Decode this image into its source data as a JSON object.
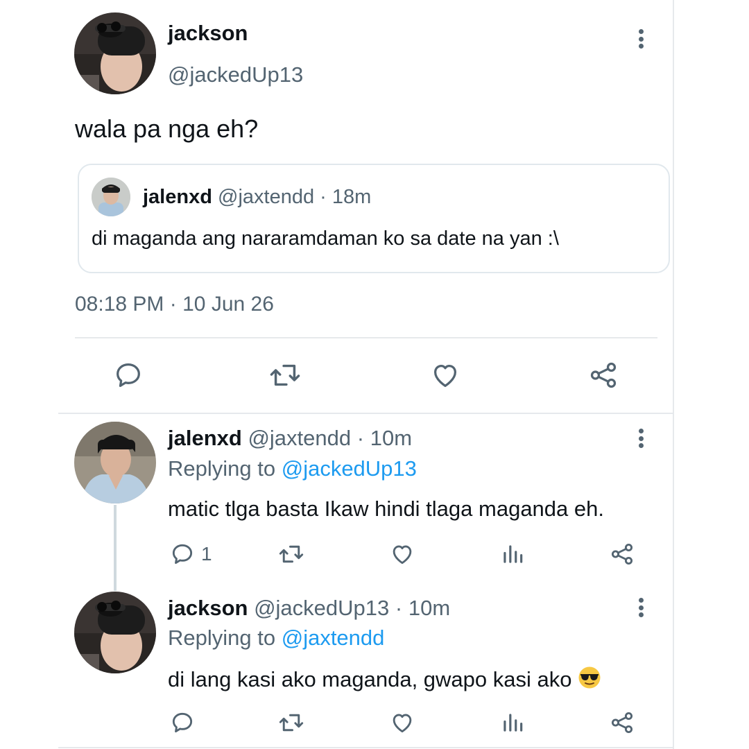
{
  "main_tweet": {
    "author_name": "jackson",
    "author_handle": "@jackedUp13",
    "text": "wala pa nga eh?",
    "quoted": {
      "author_name": "jalenxd",
      "author_handle": "@jaxtendd",
      "separator": "·",
      "time": "18m",
      "text": "di maganda ang nararamdaman ko sa date na yan :\\"
    },
    "time": "08:18 PM",
    "separator": "·",
    "date": "10 Jun 26",
    "actions": [
      "reply-icon",
      "retweet-icon",
      "like-icon",
      "share-icon"
    ]
  },
  "replies": [
    {
      "author_name": "jalenxd",
      "author_handle": "@jaxtendd",
      "separator": "·",
      "time": "10m",
      "replying_prefix": "Replying to",
      "replying_to": "@jackedUp13",
      "text": "matic tlga basta Ikaw hindi tlaga maganda eh.",
      "reply_count": "1"
    },
    {
      "author_name": "jackson",
      "author_handle": "@jackedUp13",
      "separator": "·",
      "time": "10m",
      "replying_prefix": "Replying to",
      "replying_to": "@jaxtendd",
      "text": "di lang kasi ako maganda, gwapo kasi ako",
      "emoji": "sunglasses-emoji"
    }
  ],
  "colors": {
    "text": "#0f1419",
    "secondary": "#536471",
    "link": "#1d9bf0",
    "border": "#e1e8ed"
  }
}
